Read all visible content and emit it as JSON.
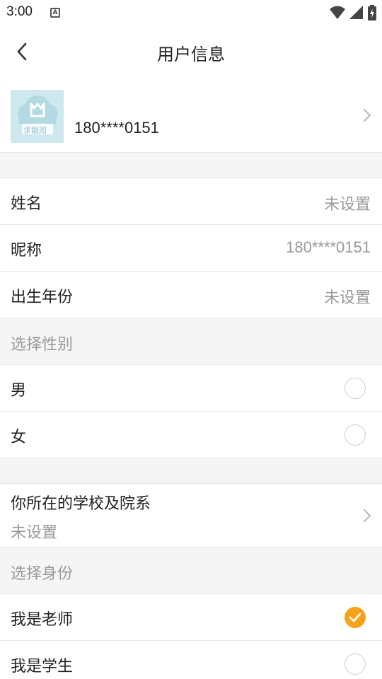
{
  "status_bar": {
    "time": "3:00",
    "notification_letter": "A",
    "icons": [
      "wifi-icon",
      "cellular-signal-icon",
      "battery-charging-icon"
    ]
  },
  "header": {
    "title": "用户信息",
    "back_icon": "chevron-left-icon"
  },
  "profile": {
    "avatar_text": "求靓照",
    "phone": "180****0151"
  },
  "info_rows": [
    {
      "label": "姓名",
      "value": "未设置"
    },
    {
      "label": "昵称",
      "value": "180****0151"
    },
    {
      "label": "出生年份",
      "value": "未设置"
    }
  ],
  "gender": {
    "header": "选择性别",
    "options": [
      {
        "label": "男",
        "selected": false
      },
      {
        "label": "女",
        "selected": false
      }
    ]
  },
  "school": {
    "label": "你所在的学校及院系",
    "value": "未设置"
  },
  "identity": {
    "header": "选择身份",
    "options": [
      {
        "label": "我是老师",
        "selected": true
      },
      {
        "label": "我是学生",
        "selected": false
      }
    ]
  },
  "colors": {
    "accent": "#f7a21b",
    "divider": "#e6e6e6",
    "section_bg": "#f5f5f5",
    "secondary_text": "#999999"
  }
}
